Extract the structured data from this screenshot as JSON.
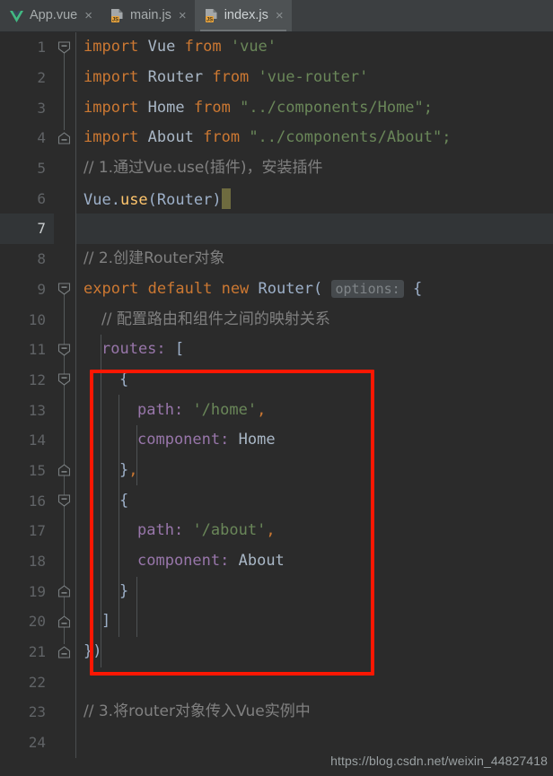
{
  "tabs": [
    {
      "label": "App.vue",
      "icon": "vue-file-icon",
      "close": "×",
      "active": false
    },
    {
      "label": "main.js",
      "icon": "js-file-icon",
      "close": "×",
      "active": false
    },
    {
      "label": "index.js",
      "icon": "js-file-icon",
      "close": "×",
      "active": true
    }
  ],
  "editor": {
    "current_line": 7,
    "line_numbers": [
      "1",
      "2",
      "3",
      "4",
      "5",
      "6",
      "7",
      "8",
      "9",
      "10",
      "11",
      "12",
      "13",
      "14",
      "15",
      "16",
      "17",
      "18",
      "19",
      "20",
      "21",
      "22",
      "23",
      "24"
    ],
    "lines": [
      {
        "n": "1",
        "text": "import Vue from 'vue'"
      },
      {
        "n": "2",
        "text": "import Router from 'vue-router'"
      },
      {
        "n": "3",
        "text": "import Home from \"../components/Home\";"
      },
      {
        "n": "4",
        "text": "import About from \"../components/About\";"
      },
      {
        "n": "5",
        "text": "// 1.通过Vue.use(插件)，安装插件"
      },
      {
        "n": "6",
        "text": "Vue.use(Router)"
      },
      {
        "n": "7",
        "text": ""
      },
      {
        "n": "8",
        "text": "// 2.创建Router对象"
      },
      {
        "n": "9",
        "text": "export default new Router( options: {"
      },
      {
        "n": "10",
        "text": "  // 配置路由和组件之间的映射关系"
      },
      {
        "n": "11",
        "text": "  routes: ["
      },
      {
        "n": "12",
        "text": "    {"
      },
      {
        "n": "13",
        "text": "      path: '/home',"
      },
      {
        "n": "14",
        "text": "      component: Home"
      },
      {
        "n": "15",
        "text": "    },"
      },
      {
        "n": "16",
        "text": "    {"
      },
      {
        "n": "17",
        "text": "      path: '/about',"
      },
      {
        "n": "18",
        "text": "      component: About"
      },
      {
        "n": "19",
        "text": "    }"
      },
      {
        "n": "20",
        "text": "  ]"
      },
      {
        "n": "21",
        "text": "})"
      },
      {
        "n": "22",
        "text": ""
      },
      {
        "n": "23",
        "text": "// 3.将router对象传入Vue实例中"
      },
      {
        "n": "24",
        "text": ""
      }
    ],
    "tokens": {
      "kw_import": "import",
      "kw_from": "from",
      "kw_export": "export",
      "kw_default": "default",
      "kw_new": "new",
      "id_vue": "Vue",
      "id_router": "Router",
      "id_home": "Home",
      "id_about": "About",
      "str_vue": "'vue'",
      "str_vuerouter": "'vue-router'",
      "str_home": "\"../components/Home\";",
      "str_about": "\"../components/About\";",
      "comment_1": "// 1.通过Vue.use(插件)，安装插件",
      "comment_2": "// 2.创建Router对象",
      "comment_3": "// 配置路由和组件之间的映射关系",
      "comment_4": "// 3.将router对象传入Vue实例中",
      "fn_use": "use",
      "hint_options": "options:",
      "prop_routes": "routes:",
      "prop_path": "path:",
      "prop_component": "component:",
      "str_path_home": "'/home'",
      "str_path_about": "'/about'",
      "vue_dot": "Vue.",
      "paren_router": "(Router)",
      "brace_open": "{",
      "brace_close_comma": "},",
      "brace_close": "}",
      "bracket_open": "[",
      "bracket_close": "]",
      "close_paren": "})",
      "comma": ",",
      "router_paren": "Router(",
      "brace_after_hint": "{"
    }
  },
  "annotation": {
    "type": "red-rectangle-highlight",
    "color": "#fc1703"
  },
  "watermark": {
    "text": "https://blog.csdn.net/weixin_44827418"
  }
}
